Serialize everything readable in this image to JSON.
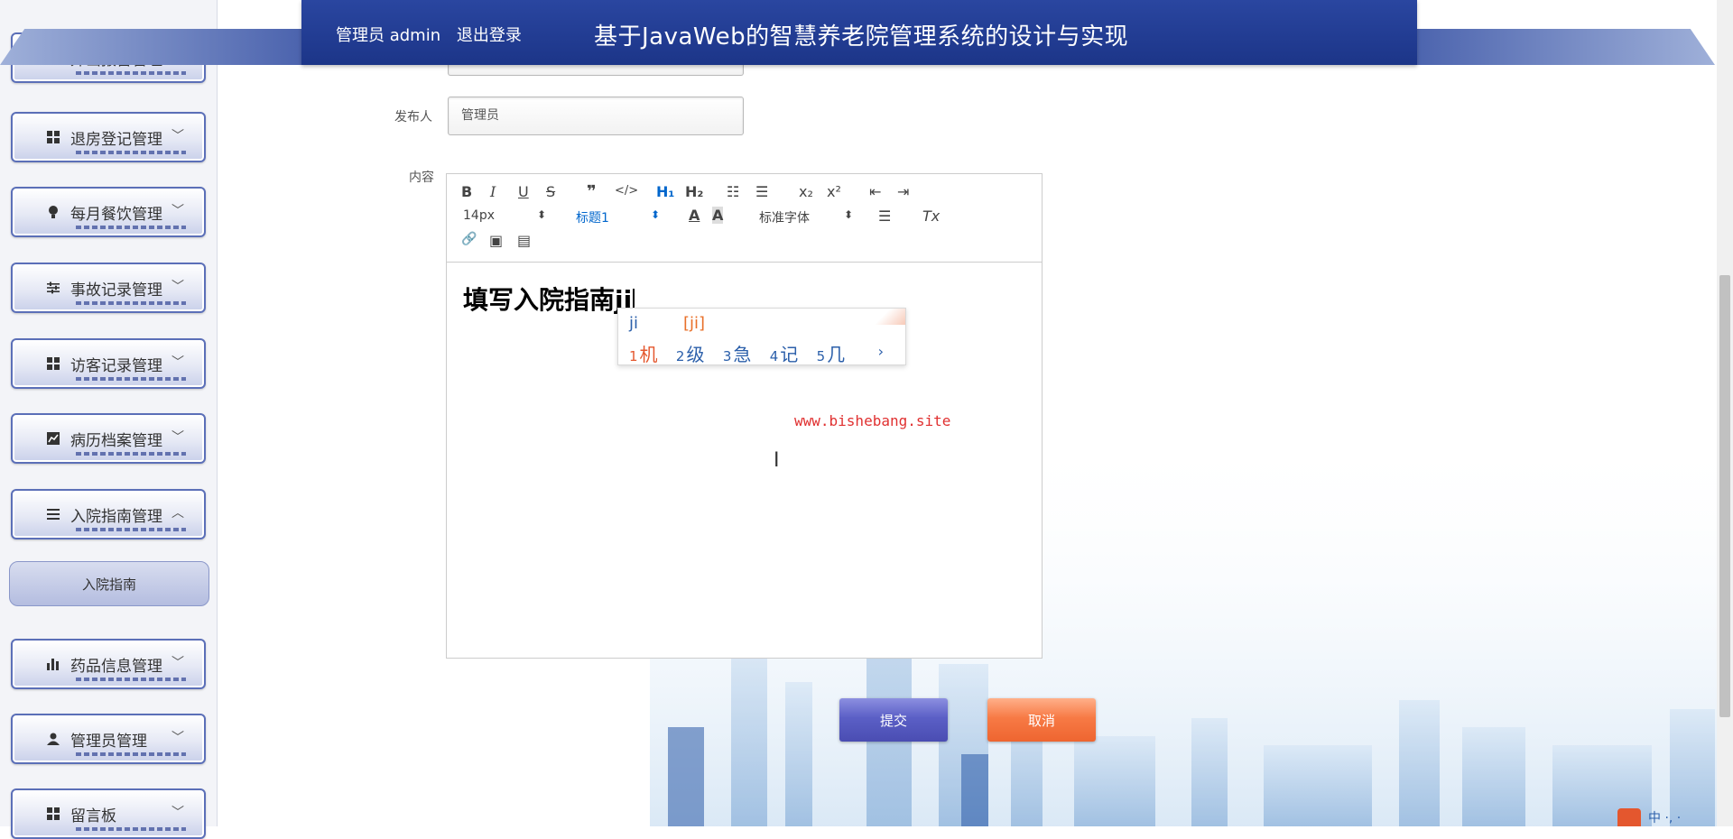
{
  "header": {
    "user_label": "管理员 admin",
    "logout_label": "退出登录",
    "title": "基于JavaWeb的智慧养老院管理系统的设计与实现"
  },
  "sidebar": {
    "items": [
      {
        "label": "外出报备管理",
        "icon": "grid-icon",
        "arrow": "﹀"
      },
      {
        "label": "退房登记管理",
        "icon": "grid-icon",
        "arrow": "﹀"
      },
      {
        "label": "每月餐饮管理",
        "icon": "lightbulb-icon",
        "arrow": "﹀"
      },
      {
        "label": "事故记录管理",
        "icon": "sliders-icon",
        "arrow": "﹀"
      },
      {
        "label": "访客记录管理",
        "icon": "grid-icon",
        "arrow": "﹀"
      },
      {
        "label": "病历档案管理",
        "icon": "chart-icon",
        "arrow": "﹀"
      },
      {
        "label": "入院指南管理",
        "icon": "list-icon",
        "arrow": "︿"
      },
      {
        "label": "药品信息管理",
        "icon": "bar-chart-icon",
        "arrow": "﹀"
      },
      {
        "label": "管理员管理",
        "icon": "user-icon",
        "arrow": "﹀"
      },
      {
        "label": "留言板",
        "icon": "grid-icon",
        "arrow": "﹀"
      }
    ],
    "sub_item": "入院指南"
  },
  "form": {
    "publisher_label": "发布人",
    "publisher_value": "管理员",
    "content_label": "内容"
  },
  "editor": {
    "toolbar": {
      "bold": "B",
      "italic": "I",
      "underline": "U",
      "strike": "S",
      "blockquote": "❞",
      "code": "</>",
      "h1": "H₁",
      "h2": "H₂",
      "ordered_list": "☷",
      "bullet_list": "☰",
      "subscript": "x₂",
      "superscript": "x²",
      "outdent": "⇤",
      "indent": "⇥",
      "font_size": "14px",
      "header_select": "标题1",
      "font_family": "标准字体",
      "color": "A",
      "background": "A",
      "align": "☰",
      "clean": "Tx",
      "link": "🔗",
      "image": "▣",
      "video": "▤",
      "select_arrow": "⬍"
    },
    "content_text": "填写入院指南ji"
  },
  "ime": {
    "composition": "ji",
    "pinyin": "[ji]",
    "candidates": [
      {
        "n": "1",
        "text": "机"
      },
      {
        "n": "2",
        "text": "级"
      },
      {
        "n": "3",
        "text": "急"
      },
      {
        "n": "4",
        "text": "记"
      },
      {
        "n": "5",
        "text": "几"
      }
    ],
    "next": "›"
  },
  "watermark": "www.bishebang.site",
  "buttons": {
    "submit": "提交",
    "cancel": "取消"
  },
  "tray": {
    "text": "中 ·, ·"
  }
}
